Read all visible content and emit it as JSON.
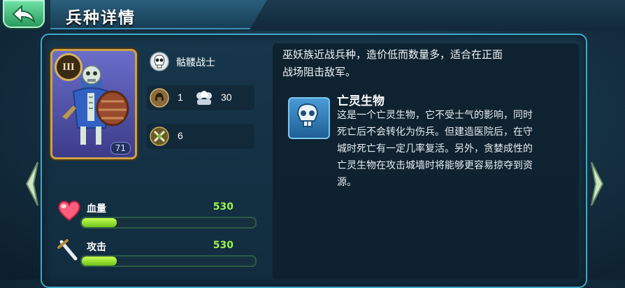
{
  "header": {
    "title": "兵种详情",
    "back_icon": "back-arrow-icon"
  },
  "unit": {
    "rank": "III",
    "level": "71",
    "name": "骷髅战士",
    "stats_row": {
      "stat_a": "1",
      "stat_b": "30"
    },
    "attack_speed_value": "6"
  },
  "stats": [
    {
      "label": "血量",
      "value": "530",
      "fill": 0.2,
      "icon": "heart-icon"
    },
    {
      "label": "攻击",
      "value": "530",
      "fill": 0.2,
      "icon": "sword-icon"
    }
  ],
  "description": {
    "lines": [
      "巫妖族近战兵种，造价低而数量多，适合在正面",
      "战场阻击敌军。"
    ]
  },
  "skill": {
    "title": "亡灵生物",
    "lines": [
      "这是一个亡灵生物，它不受士气的影响，同时",
      "死亡后不会转化为伤兵。但建造医院后，在守",
      "城时死亡有一定几率复活。另外，贪婪成性的",
      "亡灵生物在攻击城墙时将能够更容易掠夺到资",
      "源。"
    ]
  },
  "colors": {
    "accent": "#3fa9c8",
    "bar_fill": "#9ef24c",
    "back_button": "#2a9b5e"
  }
}
